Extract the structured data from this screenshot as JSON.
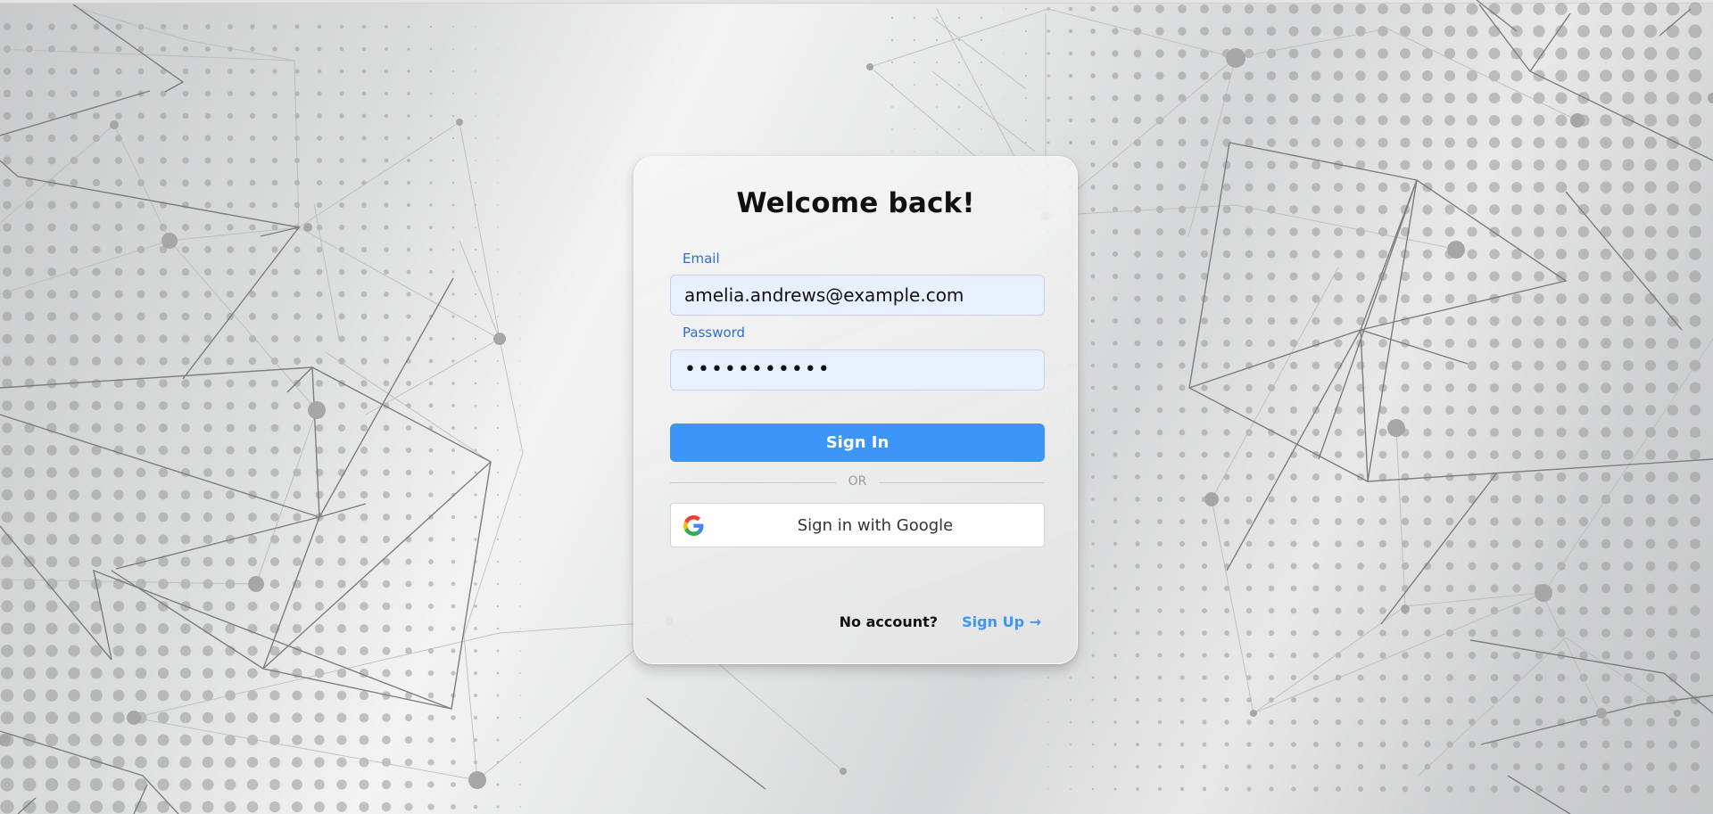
{
  "login": {
    "title": "Welcome back!",
    "email_label": "Email",
    "email_value": "amelia.andrews@example.com",
    "password_label": "Password",
    "password_value": "•••••••••••",
    "sign_in_label": "Sign In",
    "divider_text": "OR",
    "google_label": "Sign in with Google",
    "no_account_text": "No account?",
    "sign_up_label": "Sign Up →"
  },
  "colors": {
    "accent": "#3d96f7",
    "label_blue": "#2d6fd0",
    "input_bg": "#e8f0fe"
  },
  "icons": {
    "google": "google-g-icon"
  }
}
